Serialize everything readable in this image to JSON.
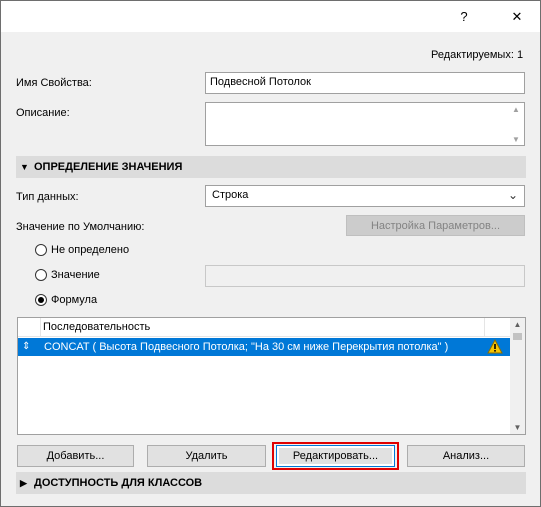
{
  "titlebar": {
    "help_label": "?",
    "close_label": "✕"
  },
  "editable_count": "Редактируемых: 1",
  "property_name": {
    "label": "Имя Свойства:",
    "value": "Подвесной Потолок"
  },
  "description": {
    "label": "Описание:",
    "value": ""
  },
  "section_definition": {
    "title": "ОПРЕДЕЛЕНИЕ ЗНАЧЕНИЯ"
  },
  "data_type": {
    "label": "Тип данных:",
    "selected": "Строка"
  },
  "default_value": {
    "label": "Значение по Умолчанию:",
    "params_button": "Настройка Параметров..."
  },
  "radios": {
    "undefined": "Не определено",
    "value": "Значение",
    "formula": "Формула",
    "selected": "formula"
  },
  "value_field": "",
  "list": {
    "header": "Последовательность",
    "rows": [
      {
        "text": "CONCAT ( Высота Подвесного Потолка; \"На 30 см ниже Перекрытия потолка\" )",
        "warning": true
      }
    ]
  },
  "buttons": {
    "add": "Добавить...",
    "delete": "Удалить",
    "edit": "Редактировать...",
    "analyze": "Анализ..."
  },
  "section_availability": {
    "title": "ДОСТУПНОСТЬ ДЛЯ КЛАССОВ"
  },
  "colors": {
    "selection": "#0078d7",
    "highlight_frame": "#e00000",
    "warning": "#f5c400"
  }
}
